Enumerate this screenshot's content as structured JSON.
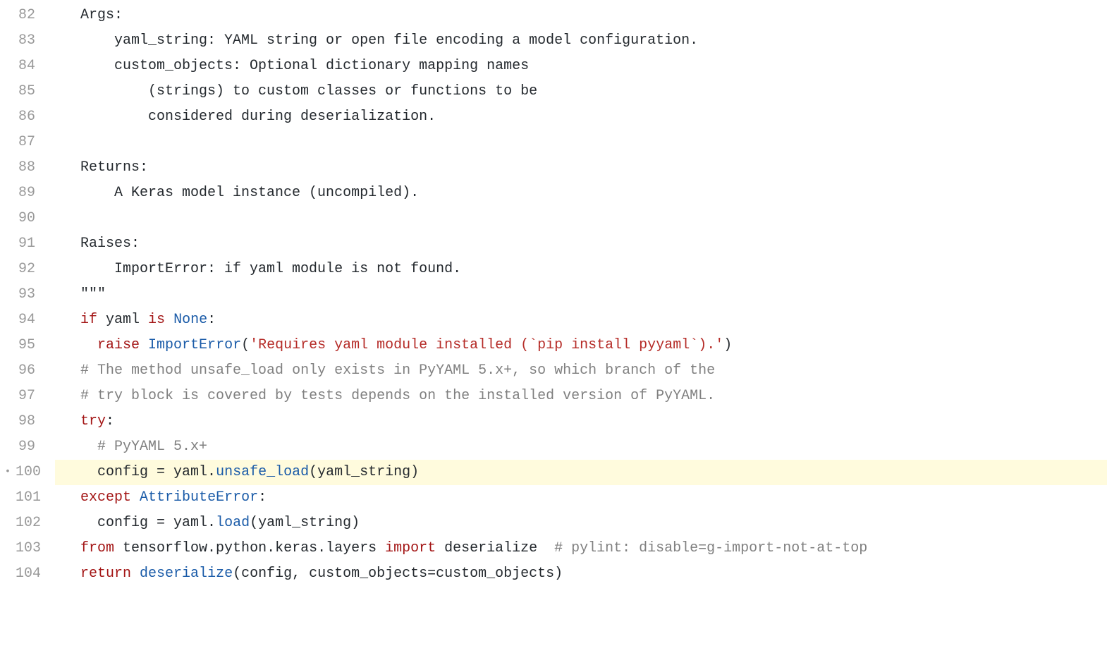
{
  "colors": {
    "keyword": "#a31515",
    "builtin": "#1a5ba8",
    "string": "#b52b27",
    "comment": "#808080",
    "plain": "#24292e",
    "highlight_bg": "#fffbdd",
    "line_number": "#999999"
  },
  "lines": [
    {
      "n": 82,
      "hl": false,
      "marker": "",
      "tokens": [
        {
          "cls": "tok-plain",
          "txt": "  Args:"
        }
      ]
    },
    {
      "n": 83,
      "hl": false,
      "marker": "",
      "tokens": [
        {
          "cls": "tok-plain",
          "txt": "      yaml_string: YAML string or open file encoding a model configuration."
        }
      ]
    },
    {
      "n": 84,
      "hl": false,
      "marker": "",
      "tokens": [
        {
          "cls": "tok-plain",
          "txt": "      custom_objects: Optional dictionary mapping names"
        }
      ]
    },
    {
      "n": 85,
      "hl": false,
      "marker": "",
      "tokens": [
        {
          "cls": "tok-plain",
          "txt": "          (strings) to custom classes or functions to be"
        }
      ]
    },
    {
      "n": 86,
      "hl": false,
      "marker": "",
      "tokens": [
        {
          "cls": "tok-plain",
          "txt": "          considered during deserialization."
        }
      ]
    },
    {
      "n": 87,
      "hl": false,
      "marker": "",
      "tokens": [
        {
          "cls": "tok-plain",
          "txt": ""
        }
      ]
    },
    {
      "n": 88,
      "hl": false,
      "marker": "",
      "tokens": [
        {
          "cls": "tok-plain",
          "txt": "  Returns:"
        }
      ]
    },
    {
      "n": 89,
      "hl": false,
      "marker": "",
      "tokens": [
        {
          "cls": "tok-plain",
          "txt": "      A Keras model instance (uncompiled)."
        }
      ]
    },
    {
      "n": 90,
      "hl": false,
      "marker": "",
      "tokens": [
        {
          "cls": "tok-plain",
          "txt": ""
        }
      ]
    },
    {
      "n": 91,
      "hl": false,
      "marker": "",
      "tokens": [
        {
          "cls": "tok-plain",
          "txt": "  Raises:"
        }
      ]
    },
    {
      "n": 92,
      "hl": false,
      "marker": "",
      "tokens": [
        {
          "cls": "tok-plain",
          "txt": "      ImportError: if yaml module is not found."
        }
      ]
    },
    {
      "n": 93,
      "hl": false,
      "marker": "",
      "tokens": [
        {
          "cls": "tok-plain",
          "txt": "  \"\"\""
        }
      ]
    },
    {
      "n": 94,
      "hl": false,
      "marker": "",
      "tokens": [
        {
          "cls": "tok-plain",
          "txt": "  "
        },
        {
          "cls": "tok-keyword",
          "txt": "if"
        },
        {
          "cls": "tok-plain",
          "txt": " yaml "
        },
        {
          "cls": "tok-keyword",
          "txt": "is"
        },
        {
          "cls": "tok-plain",
          "txt": " "
        },
        {
          "cls": "tok-builtin",
          "txt": "None"
        },
        {
          "cls": "tok-plain",
          "txt": ":"
        }
      ]
    },
    {
      "n": 95,
      "hl": false,
      "marker": "",
      "tokens": [
        {
          "cls": "tok-plain",
          "txt": "    "
        },
        {
          "cls": "tok-keyword",
          "txt": "raise"
        },
        {
          "cls": "tok-plain",
          "txt": " "
        },
        {
          "cls": "tok-builtin",
          "txt": "ImportError"
        },
        {
          "cls": "tok-plain",
          "txt": "("
        },
        {
          "cls": "tok-string",
          "txt": "'Requires yaml module installed (`pip install pyyaml`).'"
        },
        {
          "cls": "tok-plain",
          "txt": ")"
        }
      ]
    },
    {
      "n": 96,
      "hl": false,
      "marker": "",
      "tokens": [
        {
          "cls": "tok-plain",
          "txt": "  "
        },
        {
          "cls": "tok-comment",
          "txt": "# The method unsafe_load only exists in PyYAML 5.x+, so which branch of the"
        }
      ]
    },
    {
      "n": 97,
      "hl": false,
      "marker": "",
      "tokens": [
        {
          "cls": "tok-plain",
          "txt": "  "
        },
        {
          "cls": "tok-comment",
          "txt": "# try block is covered by tests depends on the installed version of PyYAML."
        }
      ]
    },
    {
      "n": 98,
      "hl": false,
      "marker": "",
      "tokens": [
        {
          "cls": "tok-plain",
          "txt": "  "
        },
        {
          "cls": "tok-keyword",
          "txt": "try"
        },
        {
          "cls": "tok-plain",
          "txt": ":"
        }
      ]
    },
    {
      "n": 99,
      "hl": false,
      "marker": "",
      "tokens": [
        {
          "cls": "tok-plain",
          "txt": "    "
        },
        {
          "cls": "tok-comment",
          "txt": "# PyYAML 5.x+"
        }
      ]
    },
    {
      "n": 100,
      "hl": true,
      "marker": "•",
      "tokens": [
        {
          "cls": "tok-plain",
          "txt": "    config "
        },
        {
          "cls": "tok-plain",
          "txt": "="
        },
        {
          "cls": "tok-plain",
          "txt": " yaml."
        },
        {
          "cls": "tok-func",
          "txt": "unsafe_load"
        },
        {
          "cls": "tok-plain",
          "txt": "(yaml_string)"
        }
      ]
    },
    {
      "n": 101,
      "hl": false,
      "marker": "",
      "tokens": [
        {
          "cls": "tok-plain",
          "txt": "  "
        },
        {
          "cls": "tok-keyword",
          "txt": "except"
        },
        {
          "cls": "tok-plain",
          "txt": " "
        },
        {
          "cls": "tok-builtin",
          "txt": "AttributeError"
        },
        {
          "cls": "tok-plain",
          "txt": ":"
        }
      ]
    },
    {
      "n": 102,
      "hl": false,
      "marker": "",
      "tokens": [
        {
          "cls": "tok-plain",
          "txt": "    config "
        },
        {
          "cls": "tok-plain",
          "txt": "="
        },
        {
          "cls": "tok-plain",
          "txt": " yaml."
        },
        {
          "cls": "tok-func",
          "txt": "load"
        },
        {
          "cls": "tok-plain",
          "txt": "(yaml_string)"
        }
      ]
    },
    {
      "n": 103,
      "hl": false,
      "marker": "",
      "tokens": [
        {
          "cls": "tok-plain",
          "txt": "  "
        },
        {
          "cls": "tok-keyword",
          "txt": "from"
        },
        {
          "cls": "tok-plain",
          "txt": " tensorflow.python.keras.layers "
        },
        {
          "cls": "tok-keyword",
          "txt": "import"
        },
        {
          "cls": "tok-plain",
          "txt": " deserialize  "
        },
        {
          "cls": "tok-comment",
          "txt": "# pylint: disable=g-import-not-at-top"
        }
      ]
    },
    {
      "n": 104,
      "hl": false,
      "marker": "",
      "tokens": [
        {
          "cls": "tok-plain",
          "txt": "  "
        },
        {
          "cls": "tok-keyword",
          "txt": "return"
        },
        {
          "cls": "tok-plain",
          "txt": " "
        },
        {
          "cls": "tok-func",
          "txt": "deserialize"
        },
        {
          "cls": "tok-plain",
          "txt": "(config, custom_objects"
        },
        {
          "cls": "tok-plain",
          "txt": "="
        },
        {
          "cls": "tok-plain",
          "txt": "custom_objects)"
        }
      ]
    }
  ]
}
